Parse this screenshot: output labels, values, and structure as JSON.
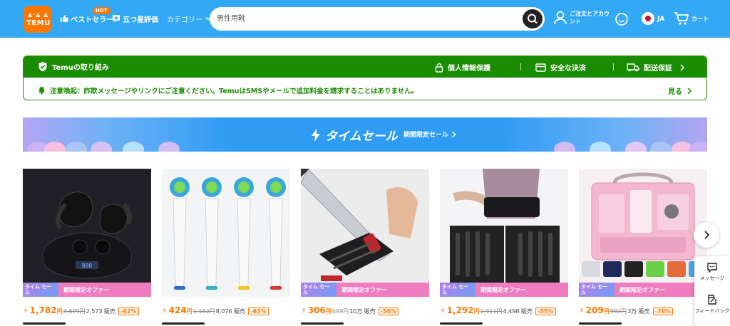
{
  "brand": {
    "logo_text": "TEMU",
    "color": "#fb7701"
  },
  "header": {
    "bestsellers": "ベストセラー",
    "hot_badge": "HOT",
    "five_star": "五つ星評価",
    "categories": "カテゴリー",
    "search_placeholder": "男性用靴",
    "account": "ご注文とアカウント",
    "language": "JA",
    "cart": "カート"
  },
  "trust": {
    "title": "Temuの取り組み",
    "privacy": "個人情報保護",
    "payment": "安全な決済",
    "delivery": "配送保証",
    "notice": "注意喚起：詐欺メッセージやリンクにご注意ください。TemuはSMSやメールで追加料金を請求することはありません。",
    "more": "見る"
  },
  "banner": {
    "title": "タイムセール",
    "subtitle": "期間限定セール"
  },
  "products": [
    {
      "price": "1,782",
      "yen": "円",
      "old": "4,699円",
      "sold": "2,573 販売",
      "discount": "-62%",
      "tag": "タイム セール",
      "strip": "期間限定オファー",
      "image": "wireless-earbuds"
    },
    {
      "price": "424",
      "yen": "円",
      "old": "1,162円",
      "sold": "8,076 販売",
      "discount": "-63%",
      "tag": "",
      "strip": "",
      "image": "toothbrush-heads"
    },
    {
      "price": "306",
      "yen": "円",
      "old": "699円",
      "sold": "10万 販売",
      "discount": "-56%",
      "tag": "タイム セール",
      "strip": "期間限定オファー",
      "image": "knife-sharpener"
    },
    {
      "price": "1,292",
      "yen": "円",
      "old": "2,911円",
      "sold": "4,498 販売",
      "discount": "-55%",
      "tag": "タイム セール",
      "strip": "期間限定オファー",
      "image": "back-support-belt"
    },
    {
      "price": "209",
      "yen": "円",
      "old": "982円",
      "sold": "3万 販売",
      "discount": "-78%",
      "tag": "タイム セール",
      "strip": "期間限定オファー",
      "image": "handbag-organizer"
    }
  ],
  "side_panel": {
    "message": "メッセージ",
    "feedback": "フィードバック"
  }
}
